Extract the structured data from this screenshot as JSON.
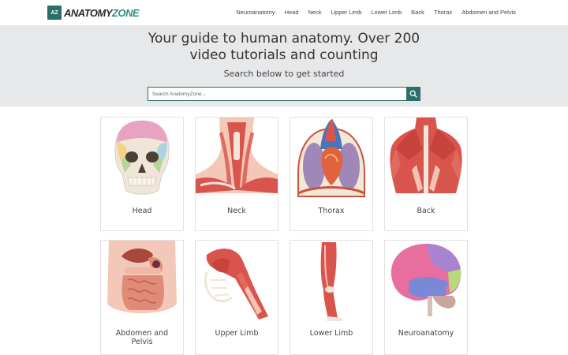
{
  "brand": {
    "mark": "AZ",
    "name_part1": "ANATOMY",
    "name_part2": "ZONE"
  },
  "nav": [
    "Neuroanatomy",
    "Head",
    "Neck",
    "Upper Limb",
    "Lower Limb",
    "Back",
    "Thorax",
    "Abdomen and Pelvis"
  ],
  "hero": {
    "title_line1": "Your guide to human anatomy. Over 200",
    "title_line2": "video tutorials and counting",
    "subtitle": "Search below to get started",
    "search_placeholder": "Search AnatomyZone..."
  },
  "cards": [
    {
      "label": "Head"
    },
    {
      "label": "Neck"
    },
    {
      "label": "Thorax"
    },
    {
      "label": "Back"
    },
    {
      "label": "Abdomen and Pelvis"
    },
    {
      "label": "Upper Limb"
    },
    {
      "label": "Lower Limb"
    },
    {
      "label": "Neuroanatomy"
    }
  ],
  "colors": {
    "brand": "#2d6e6a",
    "hero_bg": "#e7e8ea",
    "muscle": "#d9544c",
    "bone": "#efe6d8"
  }
}
